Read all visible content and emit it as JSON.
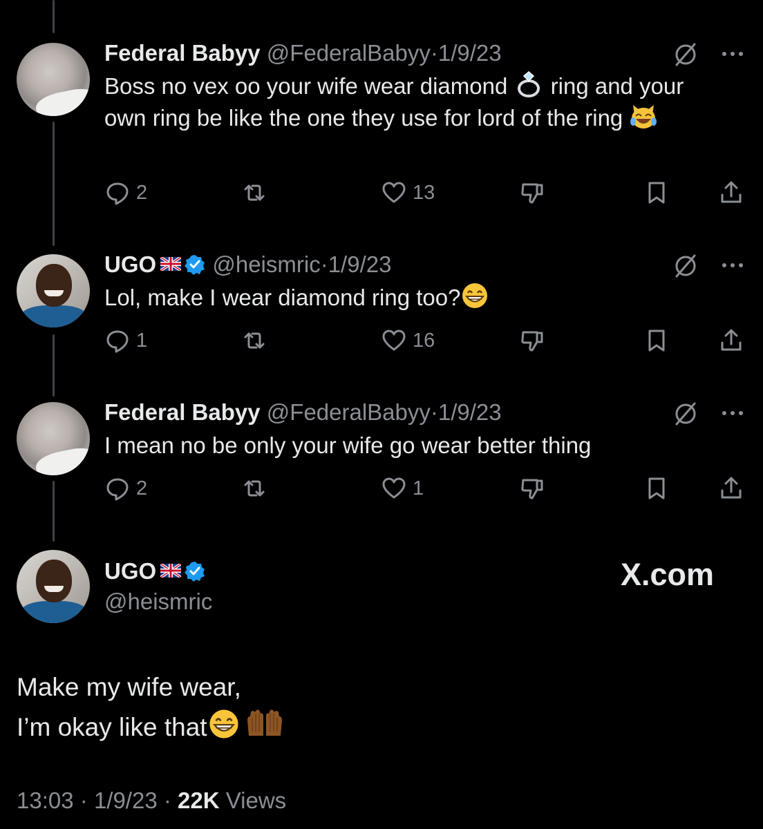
{
  "tweets": [
    {
      "author": "Federal Babyy",
      "handle": "@FederalBabyy",
      "separator": "·",
      "date": "1/9/23",
      "text_parts": [
        "Boss no vex oo  your wife wear diamond ",
        " ring and your own ring be like the one they use for lord of the ring "
      ],
      "emojis": [
        "ring-emoji",
        "cat-tears-of-joy-emoji"
      ],
      "replies": "2",
      "retweets": "",
      "likes": "13"
    },
    {
      "author": "UGO",
      "handle": "@heismric",
      "separator": "·",
      "date": "1/9/23",
      "text_parts": [
        "Lol, make I wear diamond ring too?"
      ],
      "emojis": [
        "grinning-face-emoji"
      ],
      "replies": "1",
      "retweets": "",
      "likes": "16"
    },
    {
      "author": "Federal Babyy",
      "handle": "@FederalBabyy",
      "separator": "·",
      "date": "1/9/23",
      "text_parts": [
        "I mean no be only your wife go wear better thing"
      ],
      "emojis": [],
      "replies": "2",
      "retweets": "",
      "likes": "1"
    }
  ],
  "main_tweet": {
    "author": "UGO",
    "handle": "@heismric",
    "line1": "Make my wife wear,",
    "line2": "I’m okay like that",
    "emojis": [
      "grinning-face-emoji",
      "raising-hands-emoji"
    ],
    "time": "13:03",
    "separator": "·",
    "date": "1/9/23",
    "views_count": "22K",
    "views_label": "Views"
  },
  "watermark": "X.com",
  "colors": {
    "background": "#000000",
    "text": "#e7e9ea",
    "secondary": "#8b8f94",
    "verified": "#1d9bf0",
    "thread_line": "#3e4144"
  }
}
